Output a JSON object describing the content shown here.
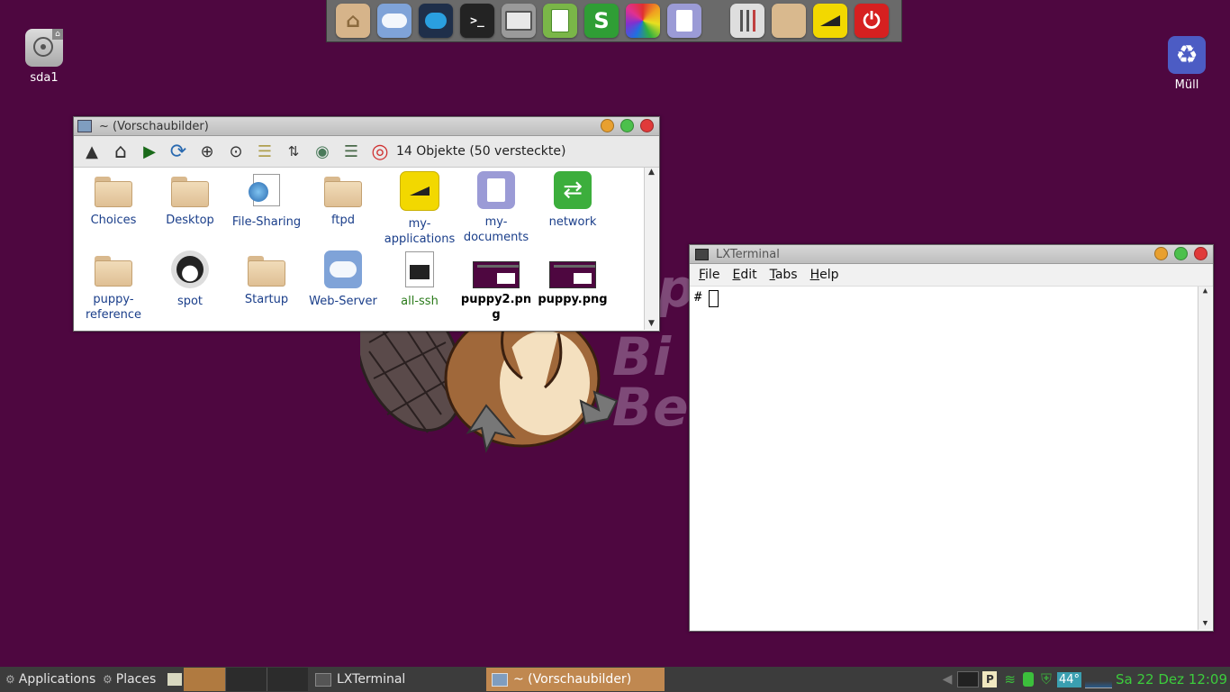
{
  "desktop": {
    "drive_label": "sda1",
    "trash_label": "Müll",
    "wallpaper_lines": [
      "p",
      "Bi",
      "Be"
    ]
  },
  "dock": {
    "items": [
      {
        "name": "home-folder-icon",
        "color": "#d6b48a"
      },
      {
        "name": "cloud-icon",
        "color": "#cfe0f5"
      },
      {
        "name": "chat-icon",
        "color": "#1e4c88"
      },
      {
        "name": "terminal-icon",
        "color": "#222222"
      },
      {
        "name": "monitor-icon",
        "color": "#cfcfcf"
      },
      {
        "name": "writer-icon",
        "color": "#7ab648"
      },
      {
        "name": "spreadsheet-icon",
        "color": "#2f9e35"
      },
      {
        "name": "color-wheel-icon",
        "color": "#e04b8a"
      },
      {
        "name": "document-icon",
        "color": "#9b9bd6"
      },
      {
        "name": "mixer-icon",
        "color": "#dedede"
      },
      {
        "name": "box-icon",
        "color": "#d9b98e"
      },
      {
        "name": "setup-icon",
        "color": "#f2d800"
      },
      {
        "name": "power-icon",
        "color": "#d62020"
      }
    ]
  },
  "filemanager": {
    "title": "~ (Vorschaubilder)",
    "status": "14 Objekte (50 versteckte)",
    "items": [
      {
        "label": "Choices",
        "kind": "folder",
        "bold": false,
        "color": "#1a3e8a"
      },
      {
        "label": "Desktop",
        "kind": "folder",
        "bold": false,
        "color": "#1a3e8a"
      },
      {
        "label": "File-Sharing",
        "kind": "share",
        "bold": false,
        "color": "#1a3e8a"
      },
      {
        "label": "ftpd",
        "kind": "folder",
        "bold": false,
        "color": "#1a3e8a"
      },
      {
        "label": "my-applications",
        "kind": "yellow",
        "bold": false,
        "color": "#1a3e8a"
      },
      {
        "label": "my-documents",
        "kind": "doc",
        "bold": false,
        "color": "#1a3e8a"
      },
      {
        "label": "network",
        "kind": "network",
        "bold": false,
        "color": "#1a3e8a"
      },
      {
        "label": "puppy-reference",
        "kind": "folder",
        "bold": false,
        "color": "#1a3e8a"
      },
      {
        "label": "spot",
        "kind": "dog",
        "bold": false,
        "color": "#1a3e8a"
      },
      {
        "label": "Startup",
        "kind": "folder",
        "bold": false,
        "color": "#1a3e8a"
      },
      {
        "label": "Web-Server",
        "kind": "cloud",
        "bold": false,
        "color": "#1a3e8a"
      },
      {
        "label": "all-ssh",
        "kind": "script",
        "bold": false,
        "color": "#2a7a1a"
      },
      {
        "label": "puppy2.png",
        "kind": "image",
        "bold": true,
        "color": "#000000"
      },
      {
        "label": "puppy.png",
        "kind": "image",
        "bold": true,
        "color": "#000000"
      }
    ]
  },
  "terminal": {
    "title": "LXTerminal",
    "menu": [
      "File",
      "Edit",
      "Tabs",
      "Help"
    ],
    "prompt": "#"
  },
  "taskbar": {
    "applications_label": "Applications",
    "places_label": "Places",
    "tasks": [
      "LXTerminal",
      "~ (Vorschaubilder)"
    ],
    "temperature": "44°",
    "clock": "Sa 22 Dez 12:09"
  }
}
